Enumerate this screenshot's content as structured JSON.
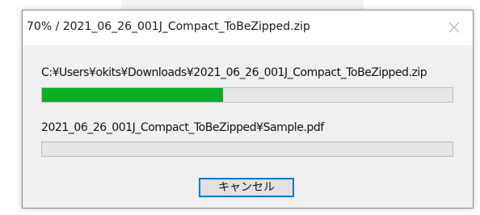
{
  "window": {
    "title": "70% / 2021_06_26_001J_Compact_ToBeZipped.zip",
    "close_icon": "close-icon"
  },
  "archive": {
    "path": "C:¥Users¥okits¥Downloads¥2021_06_26_001J_Compact_ToBeZipped.zip",
    "overall_progress": 0.44
  },
  "current_file": {
    "name": "2021_06_26_001J_Compact_ToBeZipped¥Sample.pdf",
    "progress": 0.0
  },
  "buttons": {
    "cancel_label": "キャンセル"
  },
  "colors": {
    "progress_fill": "#06b025",
    "progress_track": "#e6e6e6",
    "focus_border": "#0078d7"
  }
}
